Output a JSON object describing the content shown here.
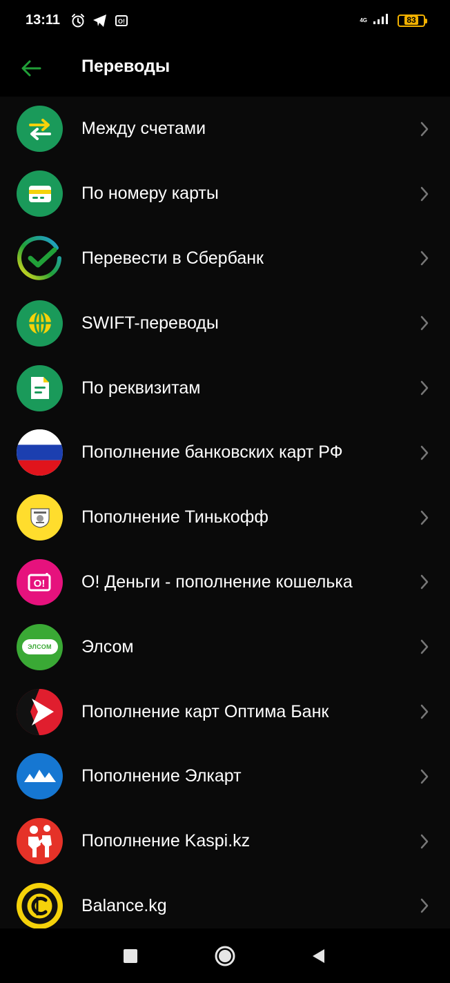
{
  "status_bar": {
    "time": "13:11",
    "network": "4G",
    "battery": "83",
    "icons": [
      "alarm-icon",
      "telegram-icon",
      "o-dengi-notification-icon",
      "signal-icon",
      "battery-icon"
    ]
  },
  "header": {
    "title": "Переводы",
    "back_icon": "arrow-left-icon",
    "accent_color": "#21a038"
  },
  "transfers": {
    "items": [
      {
        "label": "Между счетами",
        "icon": "exchange-arrows-icon"
      },
      {
        "label": "По номеру карты",
        "icon": "card-icon"
      },
      {
        "label": "Перевести в Сбербанк",
        "icon": "sberbank-logo-icon"
      },
      {
        "label": "SWIFT-переводы",
        "icon": "globe-icon"
      },
      {
        "label": "По реквизитам",
        "icon": "document-icon"
      },
      {
        "label": "Пополнение банковских карт РФ",
        "icon": "russia-flag-icon"
      },
      {
        "label": "Пополнение Тинькофф",
        "icon": "tinkoff-logo-icon"
      },
      {
        "label": "О! Деньги - пополнение кошелька",
        "icon": "o-dengi-logo-icon"
      },
      {
        "label": "Элсом",
        "icon": "elsom-logo-icon",
        "logo_text": "ЭЛСОМ"
      },
      {
        "label": "Пополнение карт Оптима Банк",
        "icon": "optima-bank-logo-icon"
      },
      {
        "label": "Пополнение Элкарт",
        "icon": "elcart-logo-icon"
      },
      {
        "label": "Пополнение Kaspi.kz",
        "icon": "kaspi-logo-icon"
      },
      {
        "label": "Balance.kg",
        "icon": "balance-kg-logo-icon"
      }
    ]
  },
  "nav_bar": {
    "icons": [
      "recents-square-icon",
      "home-circle-icon",
      "back-triangle-icon"
    ]
  }
}
